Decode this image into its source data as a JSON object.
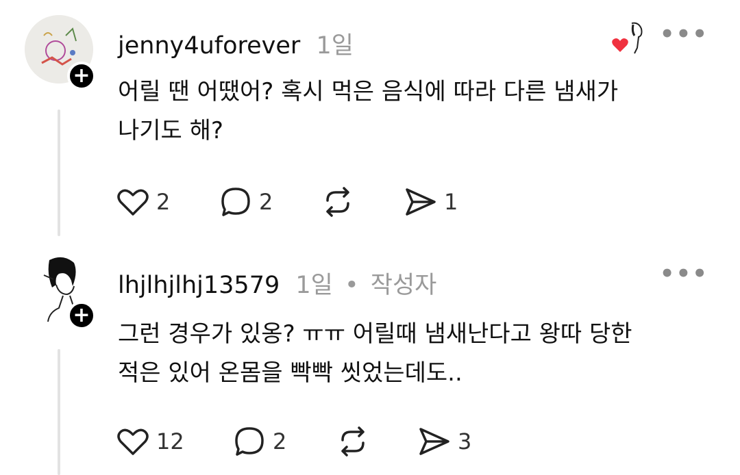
{
  "comments": [
    {
      "username": "jenny4uforever",
      "time": "1일",
      "author_tag": "",
      "text_lines": [
        "어릴 땐 어땠어? 혹시 먹은 음식에 따라 다른 냄새가",
        "나기도 해?"
      ],
      "actions": {
        "likes": "2",
        "replies": "2",
        "reposts": "",
        "shares": "1"
      },
      "liked_by_author": true,
      "more_icon": "more-horizontal-icon"
    },
    {
      "username": "lhjlhjlhj13579",
      "time": "1일",
      "author_tag": "작성자",
      "text_lines": [
        "그런 경우가 있옹? ㅠㅠ 어릴때 냄새난다고 왕따 당한",
        "적은 있어 온몸을 빡빡 씻었는데도.."
      ],
      "actions": {
        "likes": "12",
        "replies": "2",
        "reposts": "",
        "shares": "3"
      },
      "more_icon": "more-horizontal-icon"
    }
  ],
  "colors": {
    "heart": "#f0313f",
    "meta": "#9a9a9a",
    "thread_line": "#e2e2e2"
  }
}
